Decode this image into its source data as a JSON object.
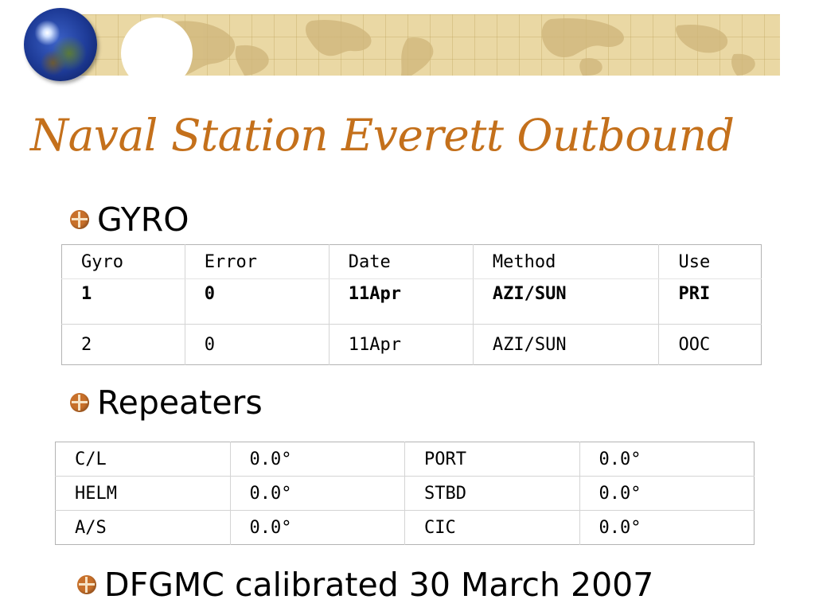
{
  "slide": {
    "title": "Naval Station Everett Outbound"
  },
  "bullets": {
    "gyro": "GYRO",
    "repeaters": "Repeaters",
    "dfgmc": "DFGMC calibrated 30 March 2007"
  },
  "gyro_table": {
    "headers": [
      "Gyro",
      "Error",
      "Date",
      "Method",
      "Use"
    ],
    "rows": [
      [
        "1",
        "0",
        "11Apr",
        "AZI/SUN",
        "PRI"
      ],
      [
        "2",
        "0",
        "11Apr",
        "AZI/SUN",
        "OOC"
      ]
    ]
  },
  "repeaters_table": {
    "rows": [
      [
        "C/L",
        "0.0°",
        "PORT",
        "0.0°"
      ],
      [
        "HELM",
        "0.0°",
        "STBD",
        "0.0°"
      ],
      [
        "A/S",
        "0.0°",
        "CIC",
        "0.0°"
      ]
    ]
  },
  "colors": {
    "title": "#c4701b",
    "banner": "#ead8a4",
    "bullet_icon": "#c8702a"
  },
  "icons": {
    "bullet": "globe-bullet-icon",
    "logo": "globe-icon"
  }
}
